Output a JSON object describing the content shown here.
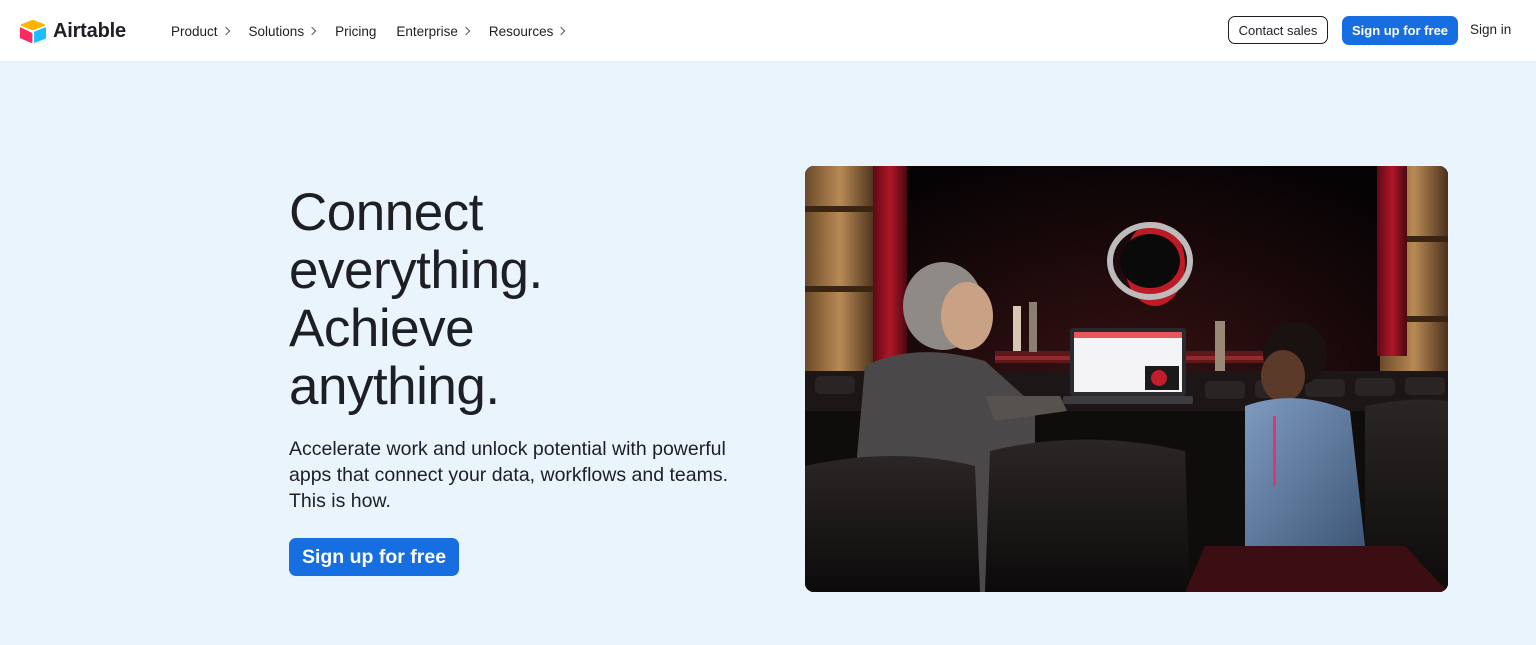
{
  "brand": {
    "name": "Airtable",
    "logo_icon": "airtable-logo-icon",
    "colors": {
      "yellow": "#fcb400",
      "red": "#f82b60",
      "blue": "#18bfff"
    }
  },
  "nav": {
    "links": [
      {
        "label": "Product",
        "has_chevron": true
      },
      {
        "label": "Solutions",
        "has_chevron": true
      },
      {
        "label": "Pricing",
        "has_chevron": false
      },
      {
        "label": "Enterprise",
        "has_chevron": true
      },
      {
        "label": "Resources",
        "has_chevron": true
      }
    ],
    "contact_label": "Contact sales",
    "signup_label": "Sign up for free",
    "signin_label": "Sign in"
  },
  "hero": {
    "headline_lines": [
      "Connect",
      "everything.",
      "Achieve",
      "anything."
    ],
    "subtext": "Accelerate work and unlock potential with powerful apps that connect your data, workflows and teams. This is how.",
    "cta_label": "Sign up for free",
    "image_icon": "hero-photo"
  },
  "colors": {
    "accent": "#166ee1",
    "hero_background": "#eaf4fc",
    "text": "#1d1f25"
  }
}
